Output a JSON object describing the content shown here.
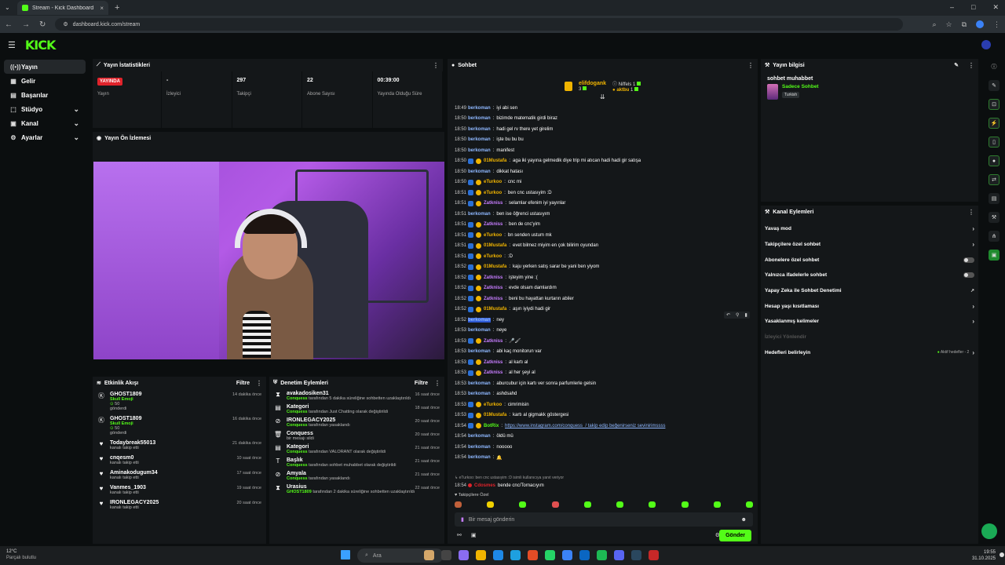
{
  "browser": {
    "tab_title": "Stream - Kick Dashboard",
    "url": "dashboard.kick.com/stream"
  },
  "header": {
    "logo": "KICK"
  },
  "sidebar": {
    "items": [
      {
        "label": "Yayın",
        "icon": "broadcast-icon",
        "active": true
      },
      {
        "label": "Gelir",
        "icon": "revenue-icon"
      },
      {
        "label": "Başarılar",
        "icon": "achievements-icon"
      },
      {
        "label": "Stüdyo",
        "icon": "studio-icon",
        "expandable": true
      },
      {
        "label": "Kanal",
        "icon": "channel-icon",
        "expandable": true
      },
      {
        "label": "Ayarlar",
        "icon": "settings-icon",
        "expandable": true
      }
    ]
  },
  "stats": {
    "title": "Yayın İstatistikleri",
    "live_badge": "YAYINDA",
    "items": [
      {
        "value": "",
        "label": "Yayın"
      },
      {
        "value": "-",
        "label": "İzleyici"
      },
      {
        "value": "297",
        "label": "Takipçi"
      },
      {
        "value": "22",
        "label": "Abone Sayısı"
      },
      {
        "value": "00:39:00",
        "label": "Yayında Olduğu Süre"
      }
    ]
  },
  "preview": {
    "title": "Yayın Ön İzlemesi"
  },
  "activity": {
    "title": "Etkinlik Akışı",
    "filter": "Filtre",
    "items": [
      {
        "name": "GHOST1809",
        "line1": "Skull Emoji",
        "line2": "50",
        "line3": "gönderdi",
        "time": "14 dakika önce",
        "icon": "kick-icon"
      },
      {
        "name": "GHOST1809",
        "line1": "Skull Emoji",
        "line2": "50",
        "line3": "gönderdi",
        "time": "16 dakika önce",
        "icon": "kick-icon"
      },
      {
        "name": "Todaybreak55013",
        "line1": "kanalı takip etti",
        "time": "21 dakika önce",
        "icon": "heart-icon"
      },
      {
        "name": "cnqesm0",
        "line1": "kanalı takip etti",
        "time": "10 saat önce",
        "icon": "heart-icon"
      },
      {
        "name": "Aminakodugum34",
        "line1": "kanalı takip etti",
        "time": "17 saat önce",
        "icon": "heart-icon"
      },
      {
        "name": "Vanmes_1903",
        "line1": "kanalı takip etti",
        "time": "19 saat önce",
        "icon": "heart-icon"
      },
      {
        "name": "IRONLEGACY2025",
        "line1": "kanalı takip etti",
        "time": "20 saat önce",
        "icon": "heart-icon"
      }
    ]
  },
  "moderation": {
    "title": "Denetim Eylemleri",
    "filter": "Filtre",
    "items": [
      {
        "name": "avakadosiken31",
        "actor": "Conquess",
        "text": "tarafından 5 dakika süreliğine sohbetten uzaklaştırıldı",
        "time": "16 saat önce",
        "icon": "hourglass-icon"
      },
      {
        "name": "Kategori",
        "actor": "Conquess",
        "text": "tarafından Just Chatting olarak değiştirildi",
        "time": "18 saat önce",
        "icon": "list-icon"
      },
      {
        "name": "IRONLEGACY2025",
        "actor": "Conquess",
        "text": "tarafından yasaklandı",
        "time": "20 saat önce",
        "icon": "ban-icon"
      },
      {
        "name": "Conquess",
        "actor": "",
        "text": "bir mesajı sildi",
        "time": "20 saat önce",
        "icon": "trash-icon"
      },
      {
        "name": "Kategori",
        "actor": "Conquess",
        "text": "tarafından VALORANT olarak değiştirildi",
        "time": "21 saat önce",
        "icon": "list-icon"
      },
      {
        "name": "Başlık",
        "actor": "Conquess",
        "text": "tarafından sohbet muhabbet olarak değiştirildi",
        "time": "21 saat önce",
        "icon": "title-icon"
      },
      {
        "name": "Amyala",
        "actor": "Conquess",
        "text": "tarafından yasaklandı",
        "time": "21 saat önce",
        "icon": "ban-icon"
      },
      {
        "name": "Urasius",
        "actor": "GHOST1809",
        "text": "tarafından 2 dakika süreliğine sohbetten uzaklaştırıldı",
        "time": "22 saat önce",
        "icon": "hourglass-icon"
      }
    ]
  },
  "chat": {
    "title": "Sohbet",
    "pinned": {
      "user1": "elifdogank",
      "count1": "3",
      "user2": "Niffels",
      "count2": "1",
      "user3": "aktbu",
      "count3": "1"
    },
    "messages": [
      {
        "t": "18:49",
        "u": "berkoman",
        "m": "iyi abi sen",
        "c": "#8fb8ff"
      },
      {
        "t": "18:50",
        "u": "berkoman",
        "m": "bizimde matematik girdi biraz",
        "c": "#8fb8ff"
      },
      {
        "t": "18:50",
        "u": "berkoman",
        "m": "hadi gel rv there yet girelim",
        "c": "#8fb8ff"
      },
      {
        "t": "18:50",
        "u": "berkoman",
        "m": "işte bu bu bu",
        "c": "#8fb8ff"
      },
      {
        "t": "18:50",
        "u": "berkoman",
        "m": "manifest",
        "c": "#8fb8ff"
      },
      {
        "t": "18:50",
        "u": "01Mustafa",
        "m": "aga iki yayına gelmedik diye trip mi atıcan hadi hadi gir satışa",
        "c": "#f0b400",
        "b": true
      },
      {
        "t": "18:50",
        "u": "berkoman",
        "m": "dikkat hatası",
        "c": "#8fb8ff"
      },
      {
        "t": "18:50",
        "u": "eTurkoo",
        "m": "cnc mi",
        "c": "#f0b400",
        "b": true
      },
      {
        "t": "18:51",
        "u": "eTurkoo",
        "m": "ben cnc ustasıyim :D",
        "c": "#f0b400",
        "b": true
      },
      {
        "t": "18:51",
        "u": "Zatkniss",
        "m": "selamlar efenim iyi yayınlar",
        "c": "#c77dff",
        "b": true
      },
      {
        "t": "18:51",
        "u": "berkoman",
        "m": "ben ise öğrenci ustasıyım",
        "c": "#8fb8ff"
      },
      {
        "t": "18:51",
        "u": "Zatkniss",
        "m": "ben de cnc'yim",
        "c": "#c77dff",
        "b": true
      },
      {
        "t": "18:51",
        "u": "eTurkoo",
        "m": "bn senden ustum mk",
        "c": "#f0b400",
        "b": true
      },
      {
        "t": "18:51",
        "u": "01Mustafa",
        "m": "evet bilmez miyim en çok bilirim oyundan",
        "c": "#f0b400",
        "b": true
      },
      {
        "t": "18:51",
        "u": "eTurkoo",
        "m": ":D",
        "c": "#f0b400",
        "b": true
      },
      {
        "t": "18:52",
        "u": "01Mustafa",
        "m": "kaju yerken satış sarar be yani ben yiyom",
        "c": "#f0b400",
        "b": true
      },
      {
        "t": "18:52",
        "u": "Zatkniss",
        "m": "işteyim yine :(",
        "c": "#c77dff",
        "b": true
      },
      {
        "t": "18:52",
        "u": "Zatkniss",
        "m": "evde olsam damlardım",
        "c": "#c77dff",
        "b": true
      },
      {
        "t": "18:52",
        "u": "Zatkniss",
        "m": "beni bu hayattan kurtarın abiler",
        "c": "#c77dff",
        "b": true
      },
      {
        "t": "18:52",
        "u": "01Mustafa",
        "m": "aşırı iyiydi hadi gir",
        "c": "#f0b400",
        "b": true
      },
      {
        "t": "18:52",
        "u": "berkoman",
        "m": "ney",
        "c": "#8fb8ff",
        "sel": true
      },
      {
        "t": "18:53",
        "u": "berkoman",
        "m": "neye",
        "c": "#8fb8ff"
      },
      {
        "t": "18:53",
        "u": "Zatkniss",
        "m": "🎤🖌",
        "c": "#c77dff",
        "b": true
      },
      {
        "t": "18:53",
        "u": "berkoman",
        "m": "abi kaç monitorun var",
        "c": "#8fb8ff"
      },
      {
        "t": "18:53",
        "u": "Zatkniss",
        "m": "al kartı al",
        "c": "#c77dff",
        "b": true
      },
      {
        "t": "18:53",
        "u": "Zatkniss",
        "m": "al her şeyi al",
        "c": "#c77dff",
        "b": true
      },
      {
        "t": "18:53",
        "u": "berkoman",
        "m": "aburcubur için kartı ver sonra parfumlerle gelsin",
        "c": "#8fb8ff"
      },
      {
        "t": "18:53",
        "u": "berkoman",
        "m": "ashdsahd",
        "c": "#8fb8ff"
      },
      {
        "t": "18:53",
        "u": "eTurkoo",
        "m": "cimrimisin",
        "c": "#f0b400",
        "b": true
      },
      {
        "t": "18:53",
        "u": "01Mustafa",
        "m": "kartı al gigmakk göstergesi",
        "c": "#f0b400",
        "b": true
      },
      {
        "t": "18:54",
        "u": "BotRix",
        "m": "https://www.instagram.com/conquess_/ takip edip beğenirseniz sevinirimssss",
        "c": "#53fc18",
        "b": true,
        "link": true
      },
      {
        "t": "18:54",
        "u": "berkoman",
        "m": "öldü mü",
        "c": "#8fb8ff"
      },
      {
        "t": "18:54",
        "u": "berkoman",
        "m": "nooooo",
        "c": "#8fb8ff"
      },
      {
        "t": "18:54",
        "u": "berkoman",
        "m": "🔔",
        "c": "#8fb8ff"
      }
    ],
    "reply_note": "eTurkoo: ben cnc ustasıyim :D isimli kullanıcıya yanıt veriyor",
    "reply_msg": {
      "t": "18:54",
      "u": "Cdosmes",
      "m": "bende cnc/Tornacıyım"
    },
    "followers_only": "Takipçilere Özel",
    "input_placeholder": "Bir mesaj gönderin",
    "send_label": "Gönder"
  },
  "stream_info": {
    "title": "Yayın bilgisi",
    "stream_title": "sohbet muhabbet",
    "category": "Sadece Sohbet",
    "language": "Turkish"
  },
  "channel_actions": {
    "title": "Kanal Eylemleri",
    "items": [
      {
        "label": "Yavaş mod",
        "kind": "chevron"
      },
      {
        "label": "Takipçilere özel sohbet",
        "kind": "chevron"
      },
      {
        "label": "Abonelere özel sohbet",
        "kind": "toggle"
      },
      {
        "label": "Yalnızca ifadelerle sohbet",
        "kind": "toggle"
      },
      {
        "label": "Yapay Zeka ile Sohbet Denetimi",
        "kind": "external"
      },
      {
        "label": "Hesap yaşı kısıtlaması",
        "kind": "chevron"
      },
      {
        "label": "Yasaklanmış kelimeler",
        "kind": "chevron"
      },
      {
        "label": "İzleyici Yönlendir",
        "kind": "disabled"
      },
      {
        "label": "Hedefleri belirleyin",
        "kind": "goal"
      }
    ],
    "goal_note": "Aktif hedefler - 2"
  },
  "taskbar": {
    "temp": "12°C",
    "weather": "Parçalı bulutlu",
    "search": "Ara",
    "time": "19:55",
    "date": "31.10.2025"
  },
  "colors": {
    "accent": "#53fc18",
    "live": "#e0232b"
  }
}
